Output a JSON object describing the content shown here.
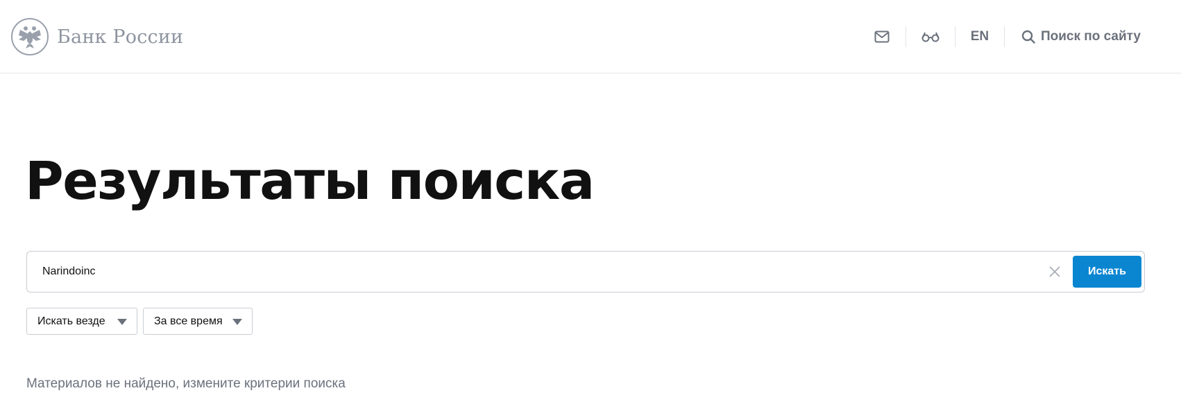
{
  "header": {
    "logo_text": "Банк России",
    "lang_label": "EN",
    "search_label": "Поиск по сайту",
    "icon_color": "#6b717c"
  },
  "main": {
    "title": "Результаты поиска",
    "search": {
      "value": "Narindoinc",
      "submit_label": "Искать",
      "accent": "#0a86d1"
    },
    "filters": {
      "where": {
        "selected": "Искать везде"
      },
      "when": {
        "selected": "За все время"
      }
    },
    "no_results_text": "Материалов не найдено, измените критерии поиска"
  }
}
